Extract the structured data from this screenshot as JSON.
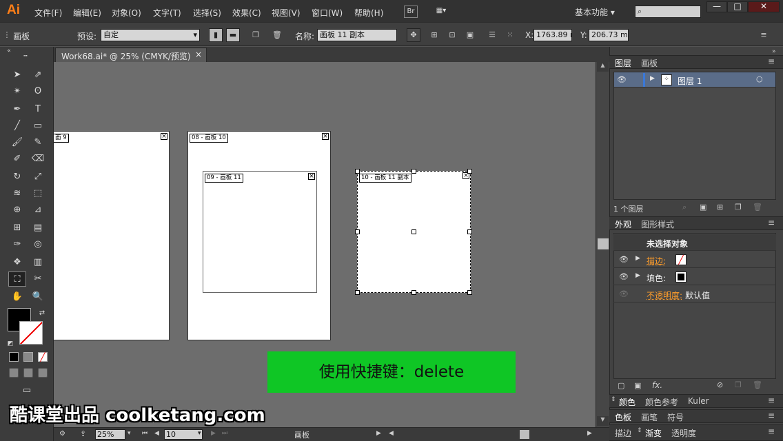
{
  "app": {
    "logo": "Ai"
  },
  "menu": [
    "文件(F)",
    "编辑(E)",
    "对象(O)",
    "文字(T)",
    "选择(S)",
    "效果(C)",
    "视图(V)",
    "窗口(W)",
    "帮助(H)"
  ],
  "menubar": {
    "bridge_label": "Br",
    "workspace": "基本功能",
    "window_buttons": [
      "—",
      "□",
      "✕"
    ]
  },
  "control": {
    "tool_name": "画板",
    "preset_label": "预设:",
    "preset_value": "自定",
    "name_label": "名称:",
    "name_value": "画板 11 副本",
    "x_label": "X:",
    "x_value": "1763.89 r",
    "y_label": "Y:",
    "y_value": "206.73 mr"
  },
  "document": {
    "tab_title": "Work68.ai* @ 25% (CMYK/预览)",
    "close": "×"
  },
  "artboards": [
    {
      "label": "面 9"
    },
    {
      "label": "08 - 画板 10"
    },
    {
      "label": "09 - 画板 11"
    },
    {
      "label": "10 - 画板 11 副本"
    }
  ],
  "status": {
    "zoom": "25%",
    "artboard_num": "10",
    "tool_label": "画板"
  },
  "layers_panel": {
    "tabs": [
      "图层",
      "画板"
    ],
    "layer_name": "图层 1",
    "count_label": "1 个图层"
  },
  "appearance_panel": {
    "tabs": [
      "外观",
      "图形样式"
    ],
    "title": "未选择对象",
    "stroke_label": "描边:",
    "fill_label": "填色:",
    "opacity_label": "不透明度:",
    "opacity_value": "默认值",
    "fx_label": "fx."
  },
  "color_panels": {
    "row1": [
      "颜色",
      "颜色参考",
      "Kuler"
    ],
    "row2": [
      "色板",
      "画笔",
      "符号"
    ],
    "row3": [
      "描边",
      "渐变",
      "透明度"
    ]
  },
  "banner": {
    "text": "使用快捷键：delete"
  },
  "watermark": {
    "text": "酷课堂出品 coolketang.com"
  },
  "colors": {
    "accent": "#ff7f18",
    "banner_green": "#0fc625",
    "canvas_gray": "#6d6d6d",
    "layer_blue": "#3a78d8"
  }
}
